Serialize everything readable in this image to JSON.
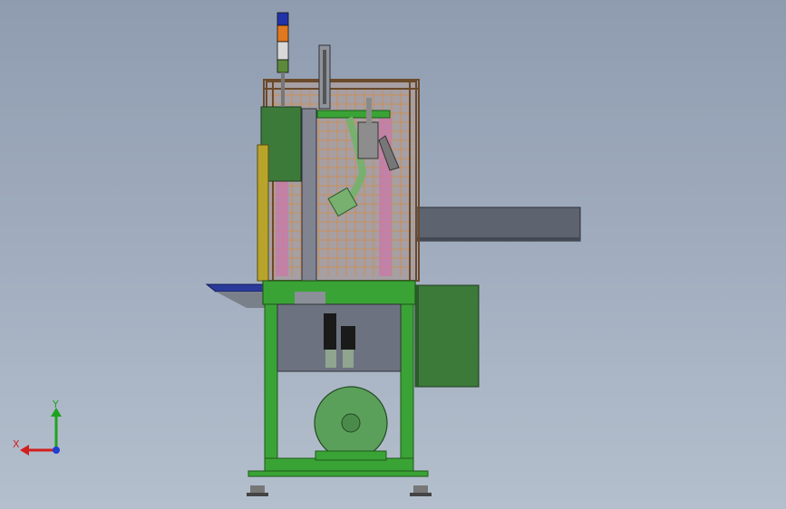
{
  "viewport": {
    "view": "front"
  },
  "triad": {
    "x_label": "X",
    "y_label": "Y",
    "x_color": "#d21f1f",
    "y_color": "#1fa21f",
    "z_color": "#1f3fd2"
  },
  "colors": {
    "frame_green": "#3aa335",
    "panel_gray": "#5e6370",
    "cabinet_green": "#3c7a3a",
    "mesh_orange": "#d98a3a",
    "tank_green": "#5aa05a",
    "beam_gray": "#5f6470",
    "stack_light_blue": "#2233aa",
    "stack_light_orange": "#e07820"
  },
  "machine": {
    "components": [
      "stack-light",
      "guard-enclosure",
      "control-box",
      "vertical-column",
      "robot-arm",
      "side-conveyor",
      "work-table",
      "base-frame",
      "pneumatic-regulators",
      "side-cabinet",
      "air-tank",
      "leveling-feet"
    ]
  }
}
